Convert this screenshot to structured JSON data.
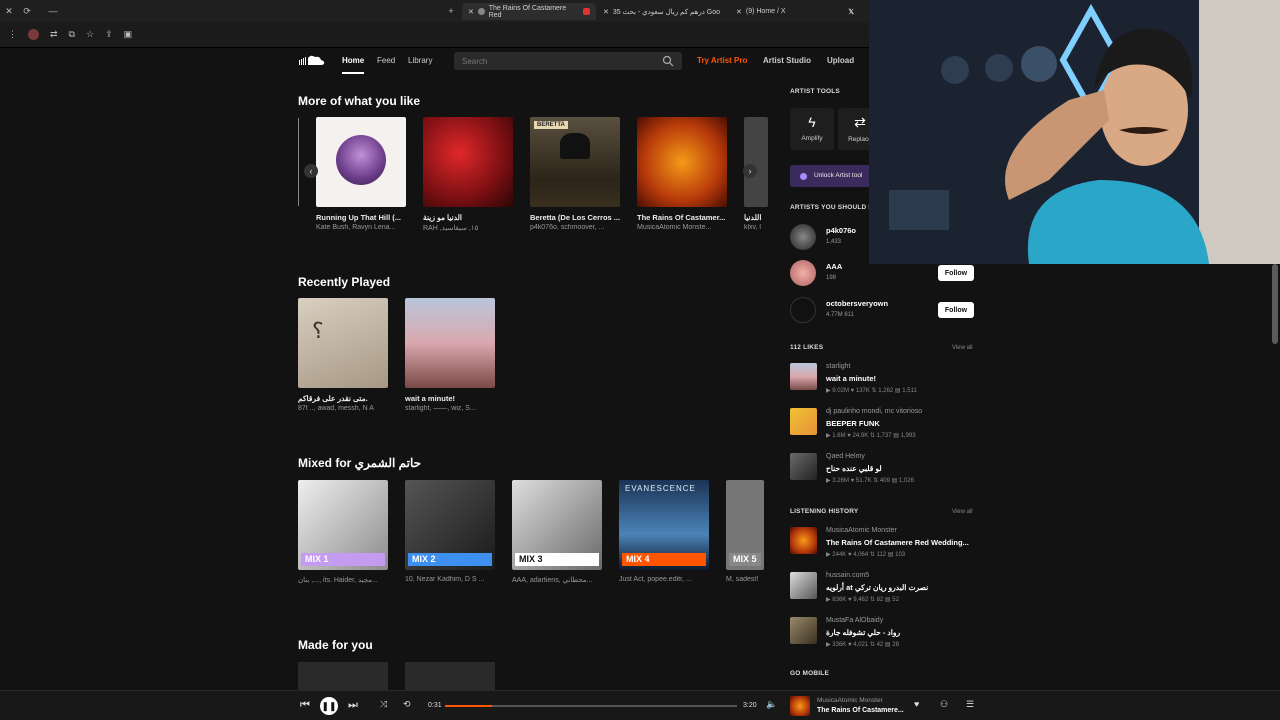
{
  "browser": {
    "tabs": [
      {
        "label": "The Rains Of Castamere Red",
        "active": true
      },
      {
        "label": "35 درهم كم ريال سعودي - بحث Goo",
        "active": false
      },
      {
        "label": "(9) Home / X",
        "active": false
      }
    ],
    "new_tab_label": "+"
  },
  "topnav": {
    "home": "Home",
    "feed": "Feed",
    "library": "Library",
    "search_placeholder": "Search",
    "try_pro": "Try Artist Pro",
    "artist_studio": "Artist Studio",
    "upload": "Upload"
  },
  "sections": {
    "more": {
      "title": "More of what you like",
      "cards": [
        {
          "title": "Running Up That Hill (...",
          "sub": "Kate Bush, Ravyn Lena..."
        },
        {
          "title": "الدنيا مو زينة",
          "sub": "RAH ,١٥, سيقاسيد"
        },
        {
          "title": "Beretta (De Los Cerros ...",
          "sub": "p4k076o, schmoover, ..."
        },
        {
          "title": "The Rains Of Castamer...",
          "sub": "MusicaAtomic Monste..."
        },
        {
          "title": "اللدنيا",
          "sub": "klxv, l"
        }
      ]
    },
    "recent": {
      "title": "Recently Played",
      "cards": [
        {
          "title": "متى نقدر على فرقاكم.",
          "sub": "87t .., awad, messh, N A"
        },
        {
          "title": "wait a minute!",
          "sub": "starlight, ——, wiz, S..."
        }
      ]
    },
    "mixed": {
      "title": "Mixed for حاتم الشمري",
      "cards": [
        {
          "badge": "MIX 1",
          "sub": "بنان ,..., its. Haider, مجيد..."
        },
        {
          "badge": "MIX 2",
          "sub": "10, Nezar Kadhim, D S ..."
        },
        {
          "badge": "MIX 3",
          "sub": "AAA, adartiens, محطاني..."
        },
        {
          "badge": "MIX 4",
          "sub": "Just Act, popee.editr, ..."
        },
        {
          "badge": "MIX 5",
          "sub": "M, sadest!"
        }
      ]
    },
    "made": {
      "title": "Made for you"
    }
  },
  "sidebar": {
    "tools_heading": "ARTIST TOOLS",
    "tools": [
      {
        "label": "Amplify",
        "icon": "bolt-icon"
      },
      {
        "label": "Replace",
        "icon": "replace-icon"
      }
    ],
    "unlock_label": "Unlock Artist tool",
    "suggest_heading": "ARTISTS YOU SHOULD FO",
    "artists": [
      {
        "name": "p4k076o",
        "stats": "1,433"
      },
      {
        "name": "AAA",
        "stats": "198",
        "follow": "Follow"
      },
      {
        "name": "octobersveryown",
        "stats": "4.77M    611",
        "follow": "Follow"
      }
    ],
    "likes_heading": "112 LIKES",
    "likes_view_all": "View all",
    "likes": [
      {
        "artist": "starlight",
        "title": "wait a minute!",
        "meta": "▶ 9.02M  ♥ 137K  ⇅ 1,262  ▤ 1,511"
      },
      {
        "artist": "dj paulinho mondi, mc vitorioso",
        "title": "BEEPER FUNK",
        "meta": "▶ 1.6M  ♥ 24.9K  ⇅ 1,737  ▤ 1,993"
      },
      {
        "artist": "Qaed Helmy",
        "title": "لو قلبي عنده حناح",
        "meta": "▶ 3.26M  ♥ 51.7K  ⇅ 409  ▤ 1,026"
      }
    ],
    "history_heading": "LISTENING HISTORY",
    "history_view_all": "View all",
    "history": [
      {
        "artist": "MusicaAtomic Monster",
        "title": "The Rains Of Castamere Red Wedding...",
        "meta": "▶ 244K  ♥ 4,064  ⇅ 112  ▤ 103"
      },
      {
        "artist": "hussain.com5",
        "title": "أرلويه at نصرت البدرو ريان تركي",
        "meta": "▶ 836K  ♥ 9,462  ⇅ 82  ▤ 52"
      },
      {
        "artist": "MustaFa AlObaidy",
        "title": "رواد - حلي تشوفله جارة",
        "meta": "▶ 336K  ♥ 4,021  ⇅ 42  ▤ 28"
      }
    ],
    "mobile_heading": "GO MOBILE"
  },
  "player": {
    "elapsed": "0:31",
    "duration": "3:20",
    "progress": 0.16,
    "now_artist": "MusicaAtomic Monster",
    "now_title": "The Rains Of Castamere..."
  },
  "colors": {
    "accent": "#ff5500",
    "background": "#121212"
  }
}
